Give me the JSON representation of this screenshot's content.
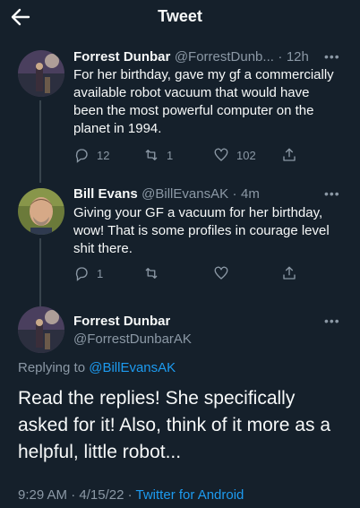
{
  "header": {
    "title": "Tweet"
  },
  "tweets": [
    {
      "name": "Forrest Dunbar",
      "handle": "@ForrestDunb...",
      "time": "12h",
      "text": "For her birthday, gave my gf a commercially available robot vacuum that would have been the most powerful computer on the planet in 1994.",
      "replies": "12",
      "retweets": "1",
      "likes": "102"
    },
    {
      "name": "Bill Evans",
      "handle": "@BillEvansAK",
      "time": "4m",
      "text": "Giving your GF a vacuum for her birthday, wow!  That is some profiles in courage level shit there.",
      "replies": "1",
      "retweets": "",
      "likes": ""
    }
  ],
  "main_tweet": {
    "name": "Forrest Dunbar",
    "handle": "@ForrestDunbarAK",
    "replying_label": "Replying to",
    "replying_to": "@BillEvansAK",
    "text": "Read the replies! She specifically asked for it! Also, think of it more as a helpful, little robot...",
    "time": "9:29 AM",
    "date": "4/15/22",
    "source": "Twitter for Android"
  },
  "icons": {
    "back": "arrow-left-icon",
    "more": "more-dots-icon",
    "reply": "reply-icon",
    "retweet": "retweet-icon",
    "like": "heart-icon",
    "share": "share-icon"
  },
  "colors": {
    "background": "#15202b",
    "text": "#f7f9f9",
    "secondary": "#8b98a5",
    "link": "#1d9bf0"
  }
}
